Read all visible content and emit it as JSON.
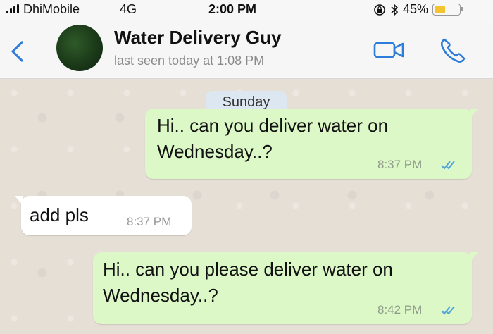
{
  "status_bar": {
    "carrier": "DhiMobile",
    "network": "4G",
    "time": "2:00 PM",
    "battery_percent": "45%",
    "battery_level": 0.45,
    "icons": [
      "signal-bars-icon",
      "orientation-lock-icon",
      "bluetooth-icon",
      "battery-icon"
    ]
  },
  "header": {
    "contact_name": "Water Delivery Guy",
    "last_seen": "last seen today at 1:08 PM",
    "icons": [
      "back-chevron-icon",
      "video-camera-icon",
      "phone-icon"
    ]
  },
  "chat": {
    "date_label": "Sunday",
    "messages": [
      {
        "direction": "outgoing",
        "lines": [
          "Hi.. can you deliver water on",
          "Wednesday..?"
        ],
        "time": "8:37 PM",
        "status": "read"
      },
      {
        "direction": "incoming",
        "lines": [
          "add pls"
        ],
        "time": "8:37 PM"
      },
      {
        "direction": "outgoing",
        "lines": [
          "Hi.. can you please deliver water on",
          "Wednesday..?"
        ],
        "time": "8:42 PM",
        "status": "read"
      }
    ]
  },
  "colors": {
    "outgoing_bubble": "#dcf8c6",
    "incoming_bubble": "#ffffff",
    "accent_blue": "#2f7ddb",
    "read_ticks": "#4fa3e0",
    "date_chip": "#dce7f2"
  }
}
